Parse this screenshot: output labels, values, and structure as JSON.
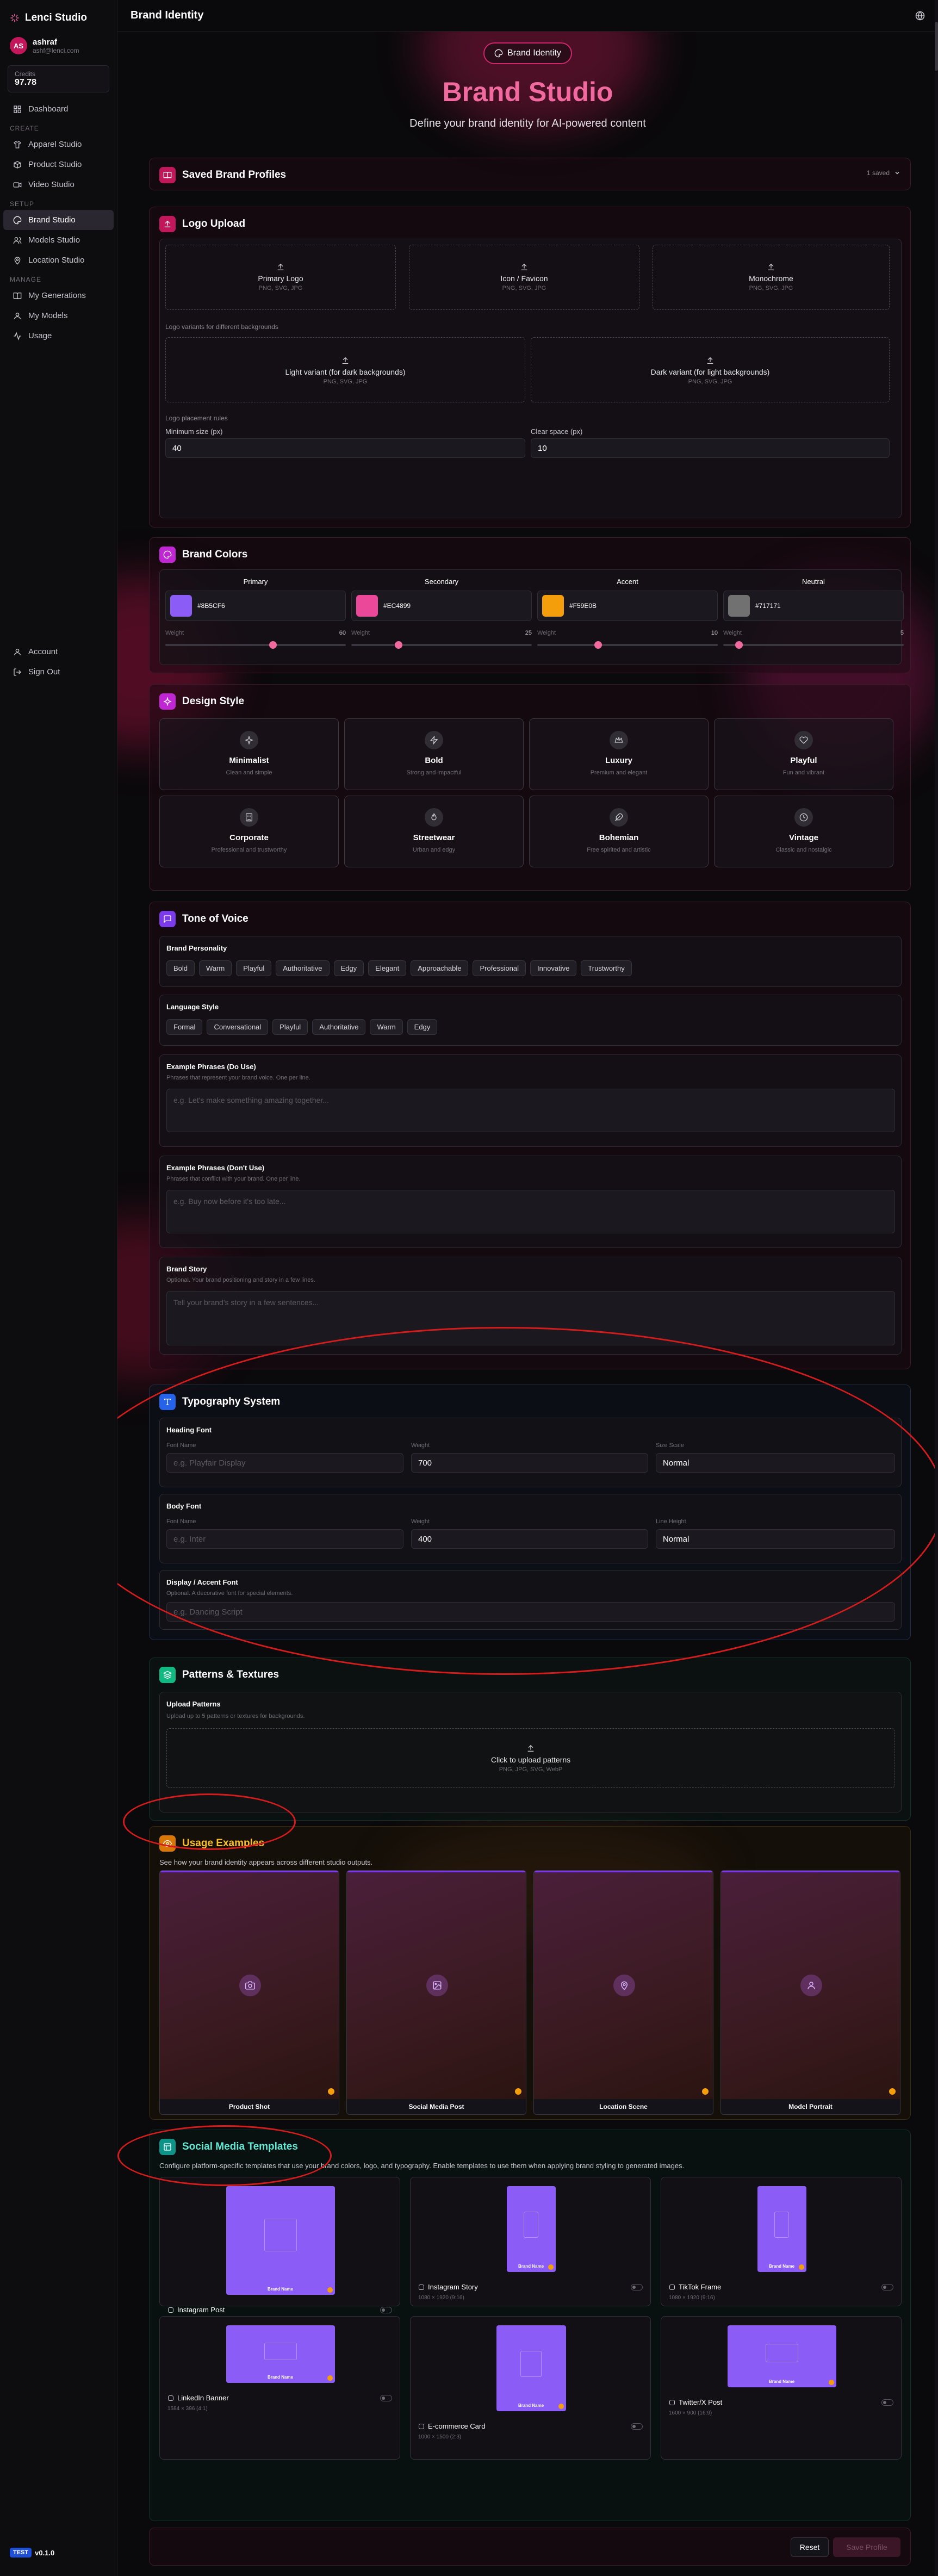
{
  "app": {
    "name": "Lenci Studio",
    "version": "v0.1.0",
    "version_badge": "TEST"
  },
  "user": {
    "initials": "AS",
    "name": "ashraf",
    "email": "ashf@lenci.com",
    "credits_label": "Credits",
    "credits_value": "97.78"
  },
  "sidebar": {
    "top": [
      {
        "label": "Dashboard"
      }
    ],
    "create_label": "CREATE",
    "create": [
      {
        "label": "Apparel Studio"
      },
      {
        "label": "Product Studio"
      },
      {
        "label": "Video Studio"
      }
    ],
    "setup_label": "SETUP",
    "setup": [
      {
        "label": "Brand Studio"
      },
      {
        "label": "Models Studio"
      },
      {
        "label": "Location Studio"
      }
    ],
    "manage_label": "MANAGE",
    "manage": [
      {
        "label": "My Generations"
      },
      {
        "label": "My Models"
      },
      {
        "label": "Usage"
      }
    ],
    "bottom": [
      {
        "label": "Account"
      },
      {
        "label": "Sign Out"
      }
    ]
  },
  "topbar": {
    "title": "Brand Identity"
  },
  "hero": {
    "pill": "Brand Identity",
    "title": "Brand Studio",
    "subtitle": "Define your brand identity for AI-powered content"
  },
  "saved": {
    "title": "Saved Brand Profiles",
    "count": "1 saved"
  },
  "logo": {
    "title": "Logo Upload",
    "slots": [
      {
        "name": "Primary Logo",
        "hint": "PNG, SVG, JPG"
      },
      {
        "name": "Icon / Favicon",
        "hint": "PNG, SVG, JPG"
      },
      {
        "name": "Monochrome",
        "hint": "PNG, SVG, JPG"
      }
    ],
    "variants_label": "Logo variants for different backgrounds",
    "variants": [
      {
        "name": "Light variant (for dark backgrounds)",
        "hint": "PNG, SVG, JPG"
      },
      {
        "name": "Dark variant (for light backgrounds)",
        "hint": "PNG, SVG, JPG"
      }
    ],
    "rules_label": "Logo placement rules",
    "min_size_label": "Minimum size (px)",
    "min_size": "40",
    "clear_space_label": "Clear space (px)",
    "clear_space": "10"
  },
  "colors": {
    "title": "Brand Colors",
    "items": [
      {
        "name": "Primary",
        "hex": "#8B5CF6",
        "color": "#8B5CF6",
        "weight_label": "Weight",
        "weight": "60",
        "pct": 0.6
      },
      {
        "name": "Secondary",
        "hex": "#EC4899",
        "color": "#EC4899",
        "weight_label": "Weight",
        "weight": "25",
        "pct": 0.25
      },
      {
        "name": "Accent",
        "hex": "#F59E0B",
        "color": "#F59E0B",
        "weight_label": "Weight",
        "weight": "10",
        "pct": 0.33
      },
      {
        "name": "Neutral",
        "hex": "#717171",
        "color": "#717171",
        "weight_label": "Weight",
        "weight": "5",
        "pct": 0.07
      }
    ]
  },
  "design": {
    "title": "Design Style",
    "styles": [
      {
        "name": "Minimalist",
        "desc": "Clean and simple"
      },
      {
        "name": "Bold",
        "desc": "Strong and impactful"
      },
      {
        "name": "Luxury",
        "desc": "Premium and elegant"
      },
      {
        "name": "Playful",
        "desc": "Fun and vibrant"
      },
      {
        "name": "Corporate",
        "desc": "Professional and trustworthy"
      },
      {
        "name": "Streetwear",
        "desc": "Urban and edgy"
      },
      {
        "name": "Bohemian",
        "desc": "Free spirited and artistic"
      },
      {
        "name": "Vintage",
        "desc": "Classic and nostalgic"
      }
    ]
  },
  "tone": {
    "title": "Tone of Voice",
    "personality_label": "Brand Personality",
    "personality": [
      "Bold",
      "Warm",
      "Playful",
      "Authoritative",
      "Edgy",
      "Elegant",
      "Approachable",
      "Professional",
      "Innovative",
      "Trustworthy"
    ],
    "language_label": "Language Style",
    "language": [
      "Formal",
      "Conversational",
      "Playful",
      "Authoritative",
      "Warm",
      "Edgy"
    ],
    "do_label": "Example Phrases (Do Use)",
    "do_hint": "Phrases that represent your brand voice. One per line.",
    "do_placeholder": "e.g. Let's make something amazing together...",
    "dont_label": "Example Phrases (Don't Use)",
    "dont_hint": "Phrases that conflict with your brand. One per line.",
    "dont_placeholder": "e.g. Buy now before it's too late...",
    "story_label": "Brand Story",
    "story_hint": "Optional. Your brand positioning and story in a few lines.",
    "story_placeholder": "Tell your brand's story in a few sentences..."
  },
  "typography": {
    "title": "Typography System",
    "heading_label": "Heading Font",
    "font_name_label": "Font Name",
    "weight_label": "Weight",
    "size_scale_label": "Size Scale",
    "line_height_label": "Line Height",
    "heading_placeholder": "e.g. Playfair Display",
    "heading_weight": "700",
    "heading_scale": "Normal",
    "body_label": "Body Font",
    "body_placeholder": "e.g. Inter",
    "body_weight": "400",
    "body_line_height": "Normal",
    "display_label": "Display / Accent Font",
    "display_hint": "Optional. A decorative font for special elements.",
    "display_placeholder": "e.g. Dancing Script"
  },
  "patterns": {
    "title": "Patterns & Textures",
    "upload_label": "Upload Patterns",
    "upload_hint": "Upload up to 5 patterns or textures for backgrounds.",
    "drop_text": "Click to upload patterns",
    "drop_hint": "PNG, JPG, SVG, WebP"
  },
  "usage": {
    "title": "Usage Examples",
    "subtitle": "See how your brand identity appears across different studio outputs.",
    "examples": [
      {
        "label": "Product Shot"
      },
      {
        "label": "Social Media Post"
      },
      {
        "label": "Location Scene"
      },
      {
        "label": "Model Portrait"
      }
    ]
  },
  "social": {
    "title": "Social Media Templates",
    "subtitle": "Configure platform-specific templates that use your brand colors, logo, and typography. Enable templates to use them when applying brand styling to generated images.",
    "brand_name": "Brand Name",
    "templates": [
      {
        "name": "Instagram Post",
        "size": "1080 × 1080 (1:1)"
      },
      {
        "name": "Instagram Story",
        "size": "1080 × 1920 (9:16)"
      },
      {
        "name": "TikTok Frame",
        "size": "1080 × 1920 (9:16)"
      },
      {
        "name": "LinkedIn Banner",
        "size": "1584 × 396 (4:1)"
      },
      {
        "name": "E-commerce Card",
        "size": "1000 × 1500 (2:3)"
      },
      {
        "name": "Twitter/X Post",
        "size": "1600 × 900 (16:9)"
      }
    ]
  },
  "actions": {
    "reset": "Reset",
    "save": "Save Profile"
  }
}
